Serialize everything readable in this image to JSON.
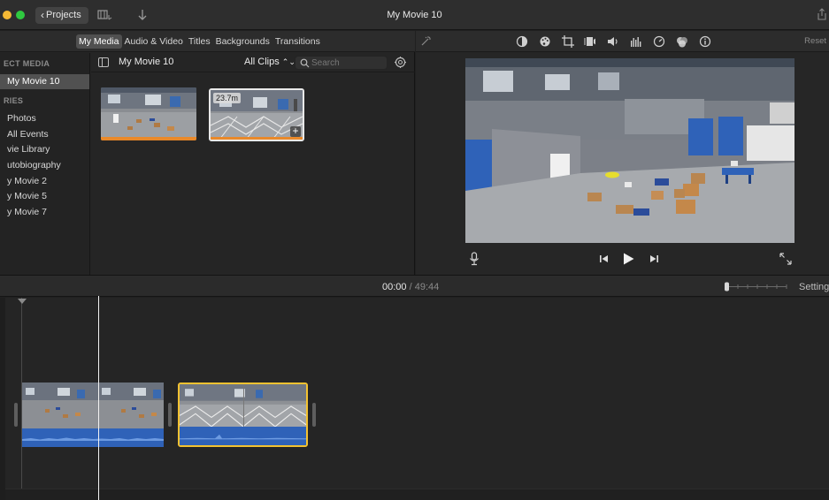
{
  "window": {
    "title": "My Movie 10",
    "projects_label": "Projects"
  },
  "browser": {
    "tabs": [
      {
        "label": "My Media",
        "active": true
      },
      {
        "label": "Audio & Video",
        "active": false
      },
      {
        "label": "Titles",
        "active": false
      },
      {
        "label": "Backgrounds",
        "active": false
      },
      {
        "label": "Transitions",
        "active": false
      }
    ],
    "sidebar": {
      "project_heading": "ECT MEDIA",
      "project_item": "My Movie 10",
      "libraries_heading": "RIES",
      "items": [
        "Photos",
        "All Events",
        "vie Library",
        "utobiography",
        "y Movie 2",
        "y Movie 5",
        "y Movie 7"
      ]
    },
    "toolbar": {
      "library_title": "My Movie 10",
      "filter_label": "All Clips",
      "search_placeholder": "Search"
    },
    "clips": [
      {
        "duration": ""
      },
      {
        "duration": "23.7m"
      }
    ]
  },
  "viewer": {
    "reset_label": "Reset"
  },
  "timeline": {
    "current_time": "00:00",
    "separator": " / ",
    "total_time": "49:44",
    "settings_label": "Setting"
  },
  "colors": {
    "audio_waveform": "#2f62b8",
    "selected_clip_border": "#f3c231",
    "clip_bar": "#e9892a"
  }
}
